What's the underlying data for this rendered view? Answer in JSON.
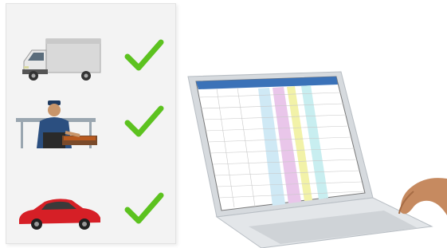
{
  "checklist": {
    "items": [
      {
        "name": "delivery-truck",
        "icon": "truck-icon",
        "status": "check"
      },
      {
        "name": "chef-grilling",
        "icon": "chef-icon",
        "status": "check"
      },
      {
        "name": "red-car",
        "icon": "car-icon",
        "status": "check"
      }
    ],
    "check_color": "#5cc21f"
  },
  "laptop": {
    "screen_app": "spreadsheet",
    "column_colors": [
      "#cfe9f5",
      "#e9c6ea",
      "#f2f2a8",
      "#c8eef0"
    ]
  }
}
